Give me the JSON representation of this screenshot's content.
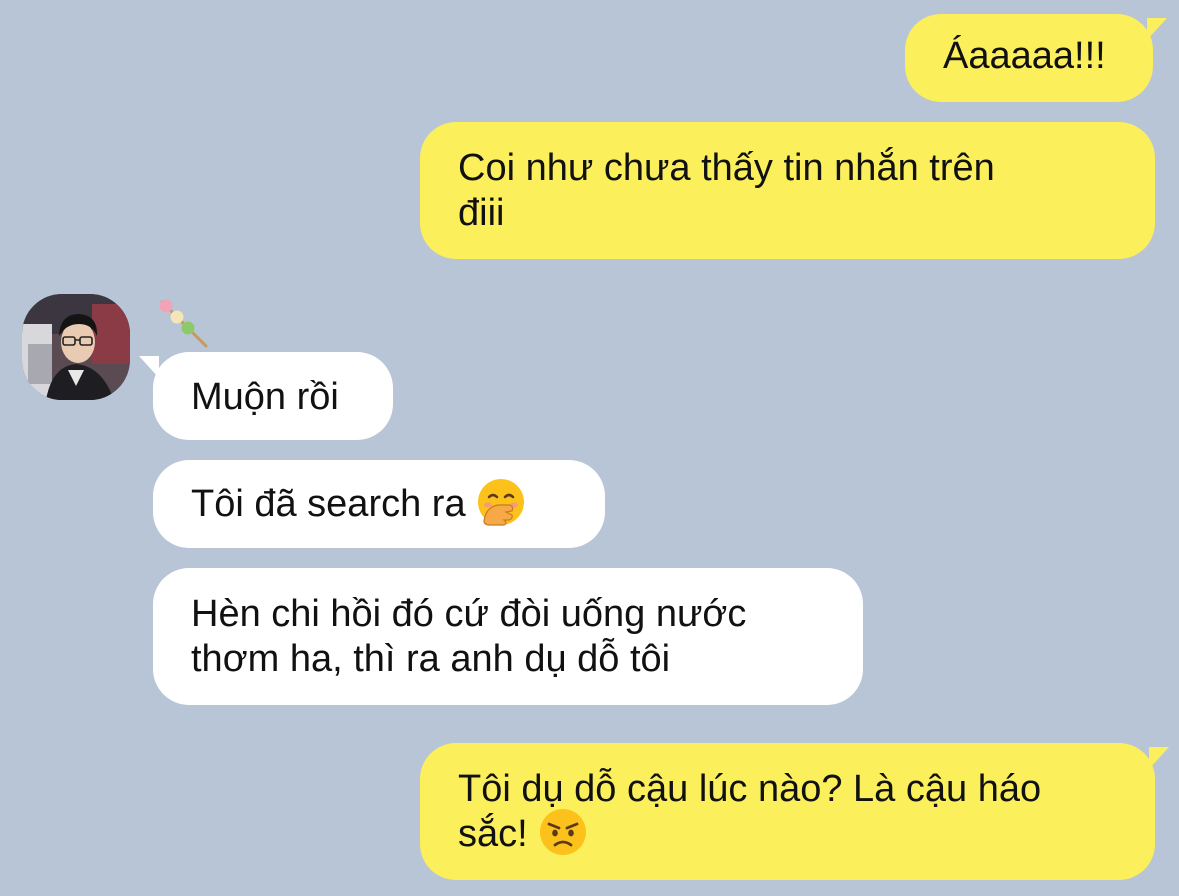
{
  "messages": [
    {
      "side": "out",
      "text": "Áaaaaa!!!"
    },
    {
      "side": "out",
      "text_line1": "Coi như chưa thấy tin nhắn trên",
      "text_line2": "điii"
    },
    {
      "side": "in",
      "text": "Muộn rồi"
    },
    {
      "side": "in",
      "text": "Tôi đã search ra",
      "emoji": "hand-over-mouth-emoji"
    },
    {
      "side": "in",
      "text_line1": "Hèn chi hồi đó cứ đòi uống nước",
      "text_line2": "thơm ha, thì ra anh dụ dỗ tôi"
    },
    {
      "side": "out",
      "text_line1": "Tôi dụ dỗ cậu lúc nào? Là cậu háo",
      "text_line2": "sắc!",
      "emoji": "angry-face-emoji"
    }
  ],
  "contact": {
    "avatar": "avatar-photo",
    "status_icon": "dango-icon"
  },
  "colors": {
    "background": "#b8c5d6",
    "outgoing_bubble": "#fbef5c",
    "incoming_bubble": "#ffffff",
    "text": "#111111"
  }
}
